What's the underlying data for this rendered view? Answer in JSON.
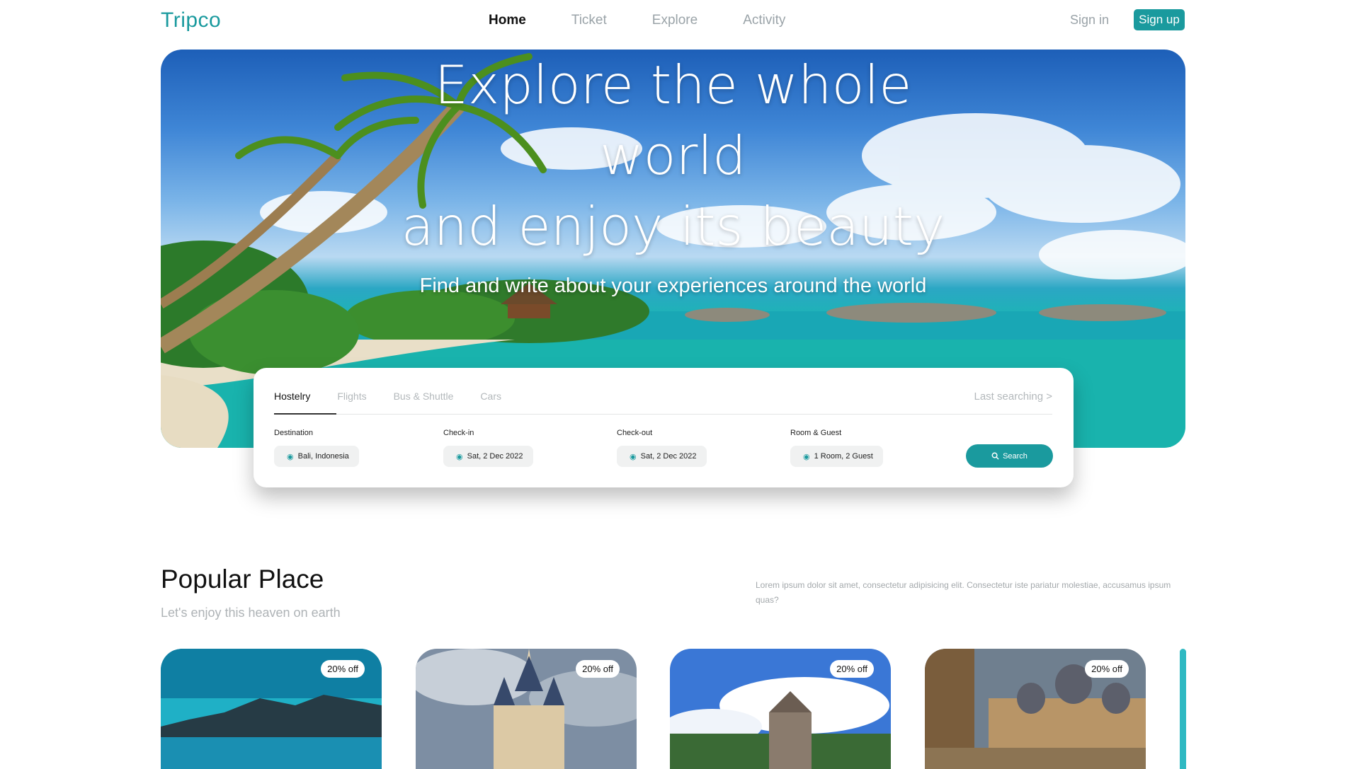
{
  "nav": {
    "brand": "Tripco",
    "links": [
      {
        "label": "Home"
      },
      {
        "label": "Ticket"
      },
      {
        "label": "Explore"
      },
      {
        "label": "Activity"
      }
    ],
    "signin": "Sign in",
    "signup": "Sign up"
  },
  "hero": {
    "title_line1": "Explore the whole",
    "title_line2": "world",
    "title_line3": "and enjoy its beauty",
    "subtitle": "Find and write about your experiences around the world"
  },
  "search": {
    "tabs": [
      "Hostelry",
      "Flights",
      "Bus & Shuttle",
      "Cars"
    ],
    "last_searching": "Last searching >",
    "fields": [
      {
        "label": "Destination",
        "value": "Bali, Indonesia"
      },
      {
        "label": "Check-in",
        "value": "Sat, 2 Dec 2022"
      },
      {
        "label": "Check-out",
        "value": "Sat, 2 Dec 2022"
      },
      {
        "label": "Room & Guest",
        "value": "1 Room, 2 Guest"
      }
    ],
    "button": "Search",
    "icons": {
      "field": "location-pin-icon",
      "button": "search-icon"
    }
  },
  "popular": {
    "title": "Popular Place",
    "subtitle": "Let's enjoy this heaven on earth",
    "description": "Lorem ipsum dolor sit amet, consectetur adipisicing elit. Consectetur iste pariatur molestiae, accusamus ipsum quas?",
    "cards": [
      {
        "badge": "20% off"
      },
      {
        "badge": "20% off"
      },
      {
        "badge": "20% off"
      },
      {
        "badge": "20% off"
      }
    ]
  },
  "colors": {
    "accent": "#1a9a9e"
  }
}
